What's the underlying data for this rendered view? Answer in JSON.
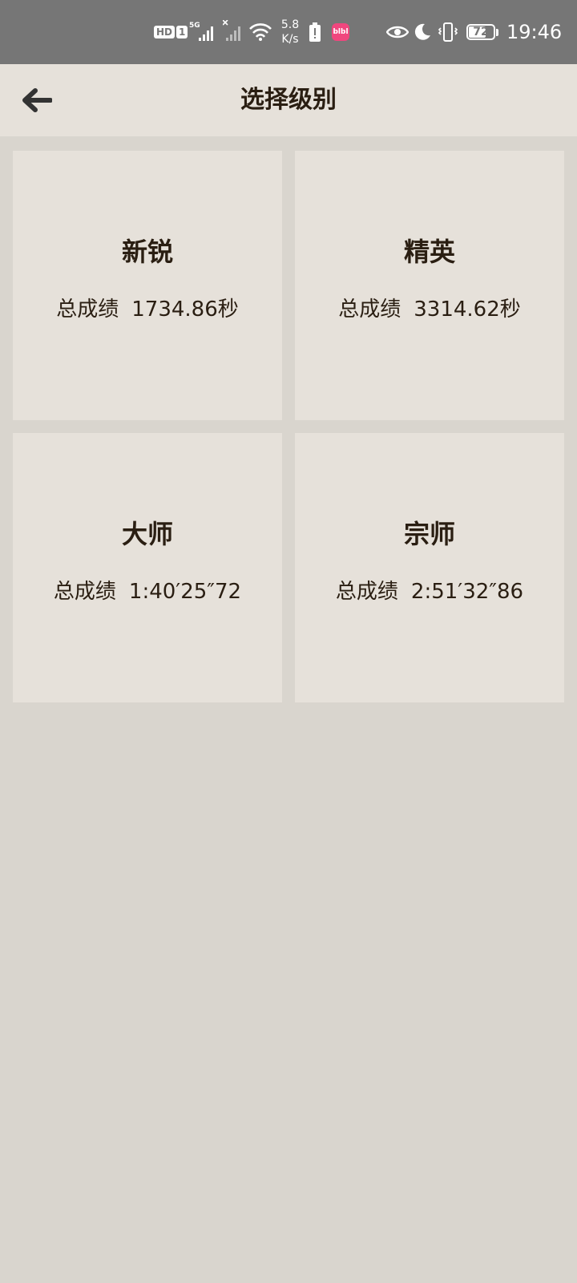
{
  "status_bar": {
    "hd_label": "HD",
    "sim_number": "1",
    "network": "5G",
    "speed_value": "5.8",
    "speed_unit": "K/s",
    "app_badge_text": "blbl",
    "battery_level": 72,
    "battery_text": "72",
    "time": "19:46"
  },
  "header": {
    "back_icon": "arrow-left-icon",
    "title": "选择级别"
  },
  "levels": [
    {
      "name": "新锐",
      "score_label": "总成绩",
      "score": "1734.86秒"
    },
    {
      "name": "精英",
      "score_label": "总成绩",
      "score": "3314.62秒"
    },
    {
      "name": "大师",
      "score_label": "总成绩",
      "score": "1:40′25″72"
    },
    {
      "name": "宗师",
      "score_label": "总成绩",
      "score": "2:51′32″86"
    }
  ],
  "colors": {
    "status_bar_bg": "#767676",
    "app_bar_bg": "#e6e1da",
    "page_bg": "#d9d5ce",
    "card_bg": "#e6e1da",
    "text": "#2a1e12"
  }
}
